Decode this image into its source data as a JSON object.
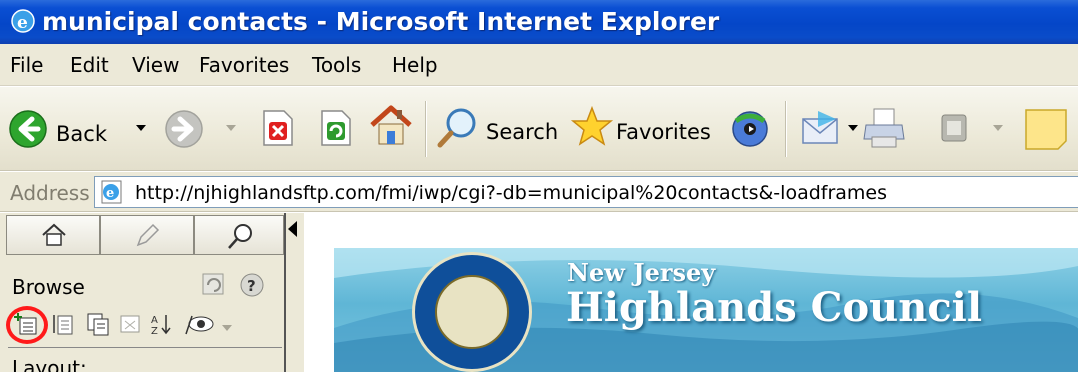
{
  "window": {
    "title": "municipal contacts - Microsoft Internet Explorer"
  },
  "menu": {
    "items": [
      "File",
      "Edit",
      "View",
      "Favorites",
      "Tools",
      "Help"
    ]
  },
  "toolbar": {
    "back_label": "Back",
    "search_label": "Search",
    "favorites_label": "Favorites"
  },
  "address": {
    "label": "Address",
    "url": "http://njhighlandsftp.com/fmi/iwp/cgi?-db=municipal%20contacts&-loadframes"
  },
  "left_frame": {
    "mode_label": "Browse",
    "layout_label": "Layout:"
  },
  "banner": {
    "line1": "New Jersey",
    "line2": "Highlands Council"
  },
  "colors": {
    "title_bar": "#0446c8",
    "chrome": "#ece9d8",
    "annotation_circle": "#ff1a1a",
    "banner_sky": "#5fb6d6"
  }
}
